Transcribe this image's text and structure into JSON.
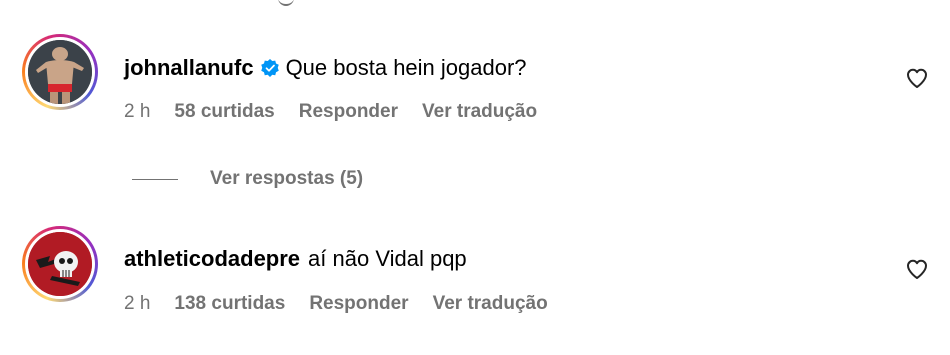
{
  "comments": [
    {
      "username": "johnallanufc",
      "verified": true,
      "text": "Que bosta hein jogador?",
      "time": "2 h",
      "likes": "58 curtidas",
      "reply_label": "Responder",
      "translate_label": "Ver tradução",
      "avatar_icon": "fighter-photo-icon"
    },
    {
      "username": "athleticodadepre",
      "verified": false,
      "text": "aí não Vidal pqp",
      "time": "2 h",
      "likes": "138 curtidas",
      "reply_label": "Responder",
      "translate_label": "Ver tradução",
      "avatar_icon": "skull-logo-icon"
    }
  ],
  "view_replies_label": "Ver respostas (5)",
  "colors": {
    "secondary_text": "#737373",
    "verified_blue": "#0095f6",
    "avatar2_bg": "#b11b24"
  }
}
